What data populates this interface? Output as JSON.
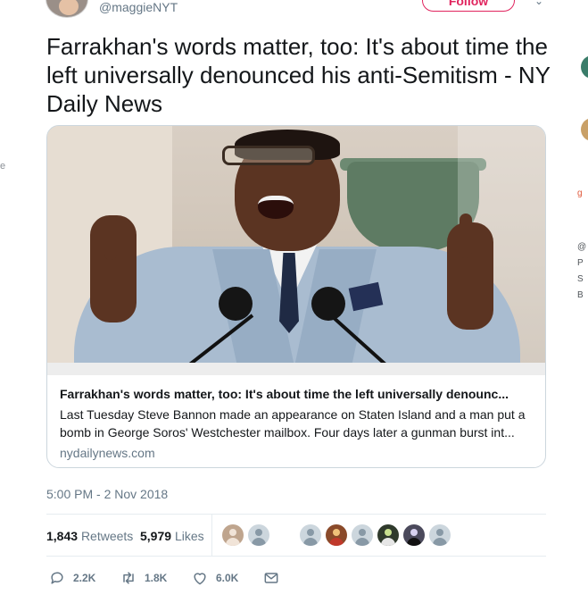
{
  "tweet": {
    "handle": "@maggieNYT",
    "follow_label": "Follow",
    "text": "Farrakhan's words matter, too: It's about time the left universally denounced his anti-Semitism - NY Daily News"
  },
  "link_card": {
    "title": "Farrakhan's words matter, too: It's about time the left universally denounc...",
    "description": "Last Tuesday Steve Bannon made an appearance on Staten Island and a man put a bomb in George Soros' Westchester mailbox. Four days later a gunman burst int...",
    "domain": "nydailynews.com"
  },
  "meta": {
    "timestamp": "5:00 PM - 2 Nov 2018"
  },
  "stats": {
    "retweets_count": "1,843",
    "retweets_label": "Retweets",
    "likes_count": "5,979",
    "likes_label": "Likes"
  },
  "actions": {
    "reply_count": "2.2K",
    "retweet_count": "1.8K",
    "like_count": "6.0K"
  },
  "side_fragments": {
    "left": "e",
    "right_orange": "g",
    "right_a": "@",
    "right_b": "P",
    "right_c": "S",
    "right_d": "B"
  },
  "colors": {
    "accent": "#e0245e",
    "muted": "#657786",
    "text": "#14171a",
    "border": "#ccd6dd"
  },
  "icons": [
    "chevron-down-icon",
    "reply-icon",
    "retweet-icon",
    "like-icon",
    "direct-message-icon"
  ]
}
